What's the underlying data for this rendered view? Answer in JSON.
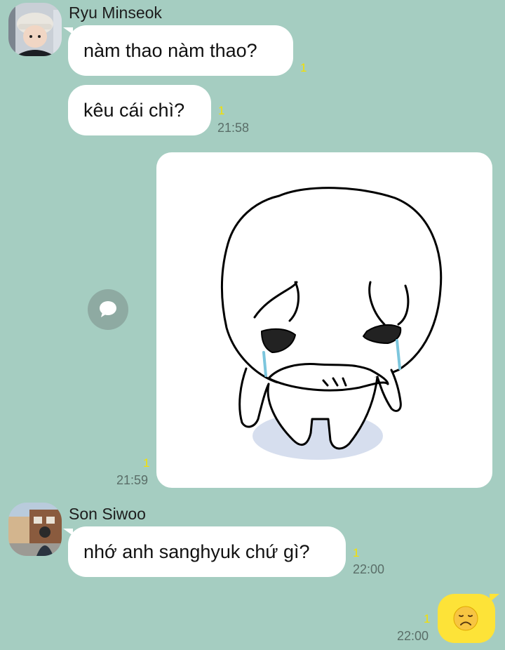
{
  "messages": [
    {
      "sender": "Ryu Minseok",
      "text": "nàm thao nàm thao?",
      "unread": "1"
    },
    {
      "text": "kêu cái chì?",
      "unread": "1",
      "time": "21:58"
    },
    {
      "type": "image",
      "unread": "1",
      "time": "21:59"
    },
    {
      "sender": "Son Siwoo",
      "text": "nhớ anh sanghyuk chứ gì?",
      "unread": "1",
      "time": "22:00"
    },
    {
      "type": "sent-emoticon",
      "emoji": "😞",
      "unread": "1",
      "time": "22:00"
    }
  ],
  "icons": {
    "share": "speech-bubble-icon"
  },
  "colors": {
    "background": "#a5cdc1",
    "bubble": "#ffffff",
    "sent_bubble": "#fde338",
    "unread": "#f5e000"
  }
}
